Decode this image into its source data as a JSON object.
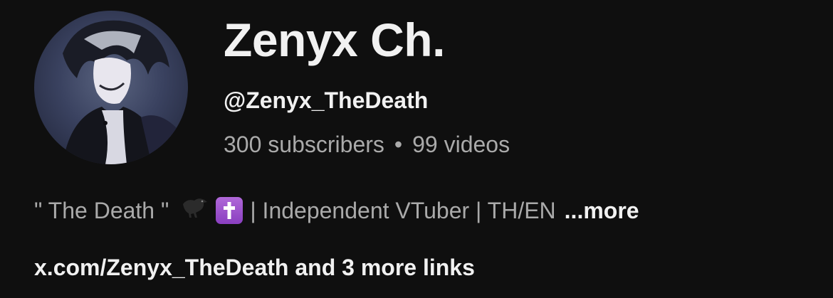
{
  "channel": {
    "name": "Zenyx Ch.",
    "handle": "@Zenyx_TheDeath",
    "subscribers": "300 subscribers",
    "separator": "•",
    "videos": "99 videos"
  },
  "description": {
    "text_before": "\" The Death \"",
    "icons": [
      "crow-icon",
      "latin-cross-icon"
    ],
    "text_after": "| Independent VTuber | TH/EN",
    "more_label": "...more"
  },
  "links": {
    "label": "x.com/Zenyx_TheDeath and 3 more links"
  },
  "colors": {
    "background": "#0f0f0f",
    "primary_text": "#f1f1f1",
    "secondary_text": "#aaaaaa",
    "cross_box": "#9b4fd0"
  }
}
